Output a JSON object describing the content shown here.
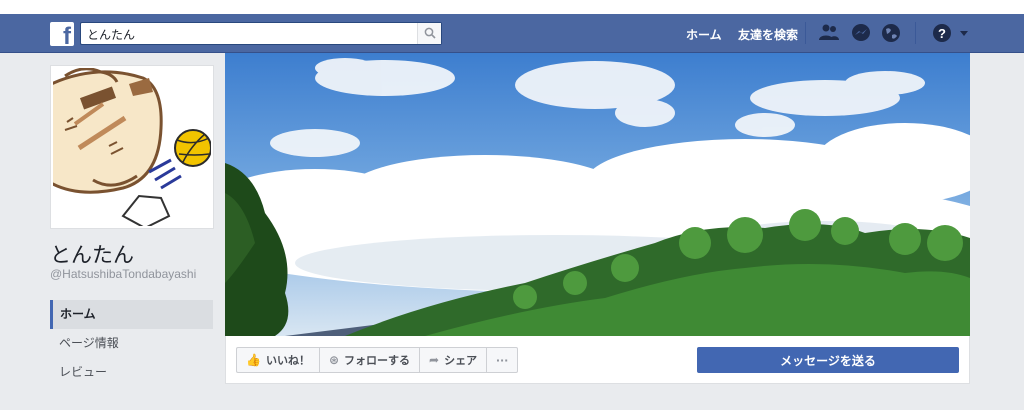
{
  "topbar": {
    "logo_letter": "f",
    "search": {
      "value": "とんたん"
    },
    "nav": {
      "home": "ホーム",
      "find_friends": "友達を検索"
    }
  },
  "profile": {
    "name": "とんたん",
    "handle": "@HatsushibaTondabayashi"
  },
  "left_nav": {
    "items": [
      {
        "label": "ホーム",
        "active": true
      },
      {
        "label": "ページ情報",
        "active": false
      },
      {
        "label": "レビュー",
        "active": false
      }
    ]
  },
  "actions": {
    "like": "いいね！",
    "follow": "フォローする",
    "share": "シェア",
    "more": "···",
    "message": "メッセージを送る"
  },
  "colors": {
    "brand_blue": "#4b67a1",
    "button_blue": "#4267b2",
    "page_bg": "#e9ebee"
  }
}
